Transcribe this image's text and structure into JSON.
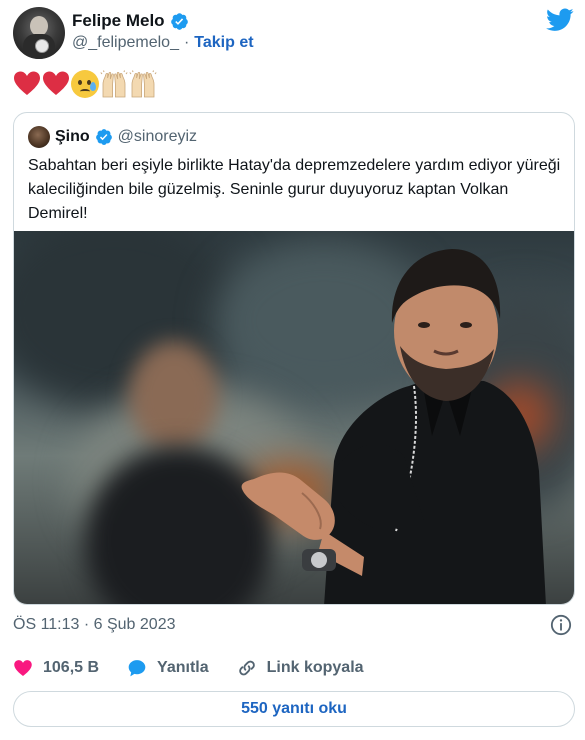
{
  "author": {
    "name": "Felipe Melo",
    "handle": "@_felipemelo_",
    "separator": "·",
    "follow_label": "Takip et"
  },
  "tweet": {
    "emojis": [
      "red-heart",
      "red-heart",
      "crying-face",
      "raising-hands",
      "raising-hands"
    ]
  },
  "quoted": {
    "name": "Şino",
    "handle": "@sinoreyiz",
    "text": "Sabahtan beri eşiyle birlikte Hatay'da depremzedelere yardım ediyor yüreği kaleciliğinden bile güzelmiş. Seninle gurur duyuyoruz kaptan Volkan Demirel!"
  },
  "meta": {
    "timestamp": "ÖS 11:13 · 6 Şub 2023"
  },
  "actions": {
    "likes": "106,5 B",
    "reply_label": "Yanıtla",
    "copy_link_label": "Link kopyala"
  },
  "replies_button": "550 yanıtı oku",
  "colors": {
    "accent": "#1d9bf0",
    "link": "#1d65c1",
    "like": "#f91880",
    "secondary_text": "#536471",
    "border": "#cfd9de"
  }
}
